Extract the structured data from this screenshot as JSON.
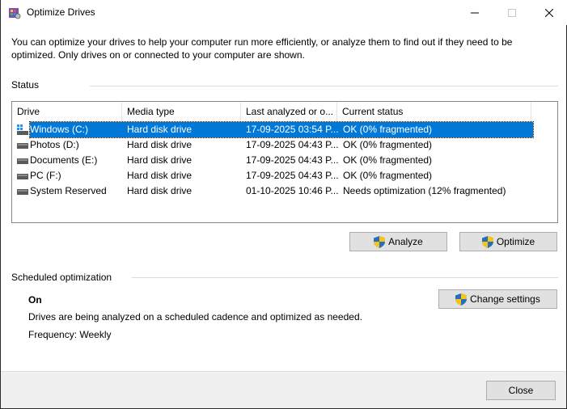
{
  "window": {
    "title": "Optimize Drives"
  },
  "intro": {
    "text": "You can optimize your drives to help your computer run more efficiently, or analyze them to find out if they need to be optimized. Only drives on or connected to your computer are shown."
  },
  "status": {
    "label": "Status",
    "columns": [
      "Drive",
      "Media type",
      "Last analyzed or o...",
      "Current status"
    ],
    "rows": [
      {
        "drive": "Windows (C:)",
        "media": "Hard disk drive",
        "last": "17-09-2025 03:54 P...",
        "status": "OK (0% fragmented)",
        "icon": "windows-drive-icon",
        "selected": true
      },
      {
        "drive": "Photos (D:)",
        "media": "Hard disk drive",
        "last": "17-09-2025 04:43 P...",
        "status": "OK (0% fragmented)",
        "icon": "hard-drive-icon",
        "selected": false
      },
      {
        "drive": "Documents (E:)",
        "media": "Hard disk drive",
        "last": "17-09-2025 04:43 P...",
        "status": "OK (0% fragmented)",
        "icon": "hard-drive-icon",
        "selected": false
      },
      {
        "drive": "PC (F:)",
        "media": "Hard disk drive",
        "last": "17-09-2025 04:43 P...",
        "status": "OK (0% fragmented)",
        "icon": "hard-drive-icon",
        "selected": false
      },
      {
        "drive": "System Reserved",
        "media": "Hard disk drive",
        "last": "01-10-2025 10:46 P...",
        "status": "Needs optimization (12% fragmented)",
        "icon": "hard-drive-icon",
        "selected": false
      }
    ],
    "analyze_label": "Analyze",
    "optimize_label": "Optimize"
  },
  "scheduled": {
    "label": "Scheduled optimization",
    "state": "On",
    "description": "Drives are being analyzed on a scheduled cadence and optimized as needed.",
    "frequency": "Frequency: Weekly",
    "change_label": "Change settings"
  },
  "footer": {
    "close_label": "Close"
  },
  "colors": {
    "selection": "#0078d7",
    "button_face": "#e1e1e1",
    "footer_bg": "#f0f0f0"
  }
}
